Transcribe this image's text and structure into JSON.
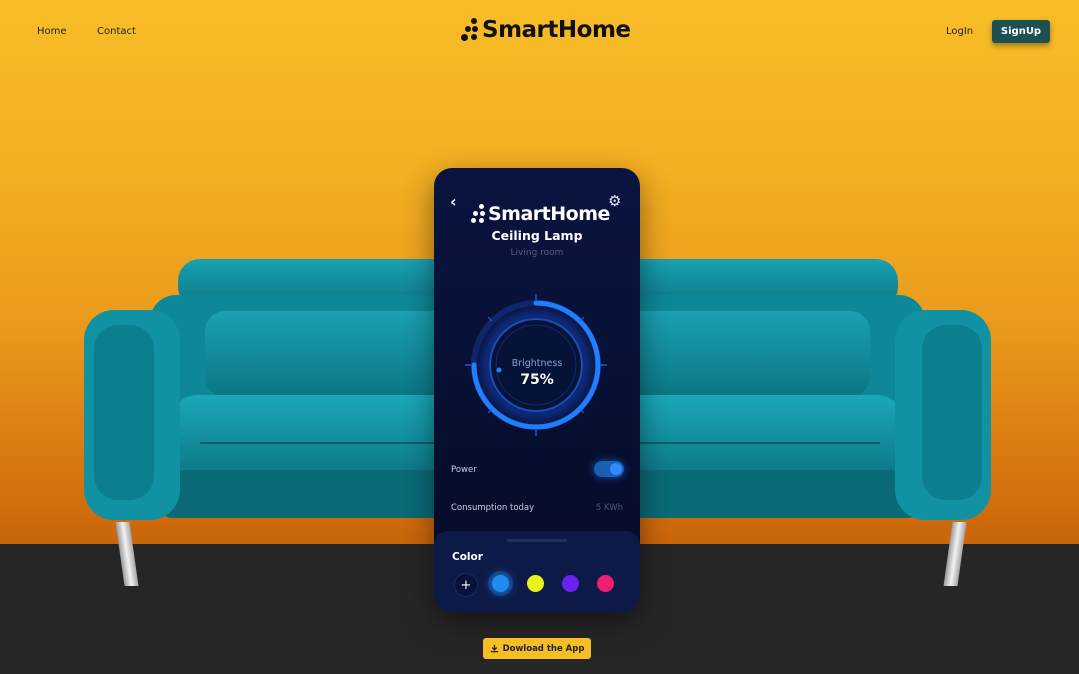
{
  "nav": {
    "home": "Home",
    "contact": "Contact",
    "login": "LogIn",
    "signup": "SignUp"
  },
  "brand": {
    "name": "SmartHome"
  },
  "phone": {
    "back_icon": "chevron-left-icon",
    "settings_icon": "gear-icon",
    "brand": "SmartHome",
    "device": "Ceiling Lamp",
    "room": "Living room",
    "dial": {
      "label": "Brightness",
      "value": "75%",
      "level": 0.75
    },
    "power": {
      "label": "Power",
      "on": true
    },
    "consumption": {
      "label": "Consumption today",
      "value": "5 KWh"
    },
    "color_panel": {
      "title": "Color",
      "swatches": [
        "#1e8cf0",
        "#e8f21f",
        "#6a22f0",
        "#ee1f6e"
      ],
      "selected": 0
    }
  },
  "download": {
    "label": "Dowload the App",
    "icon": "download-icon"
  },
  "colors": {
    "accent": "#f5bf24",
    "signup_bg": "#1e4f52",
    "phone_bg": "#0b1440",
    "sofa": "#1595a6"
  }
}
